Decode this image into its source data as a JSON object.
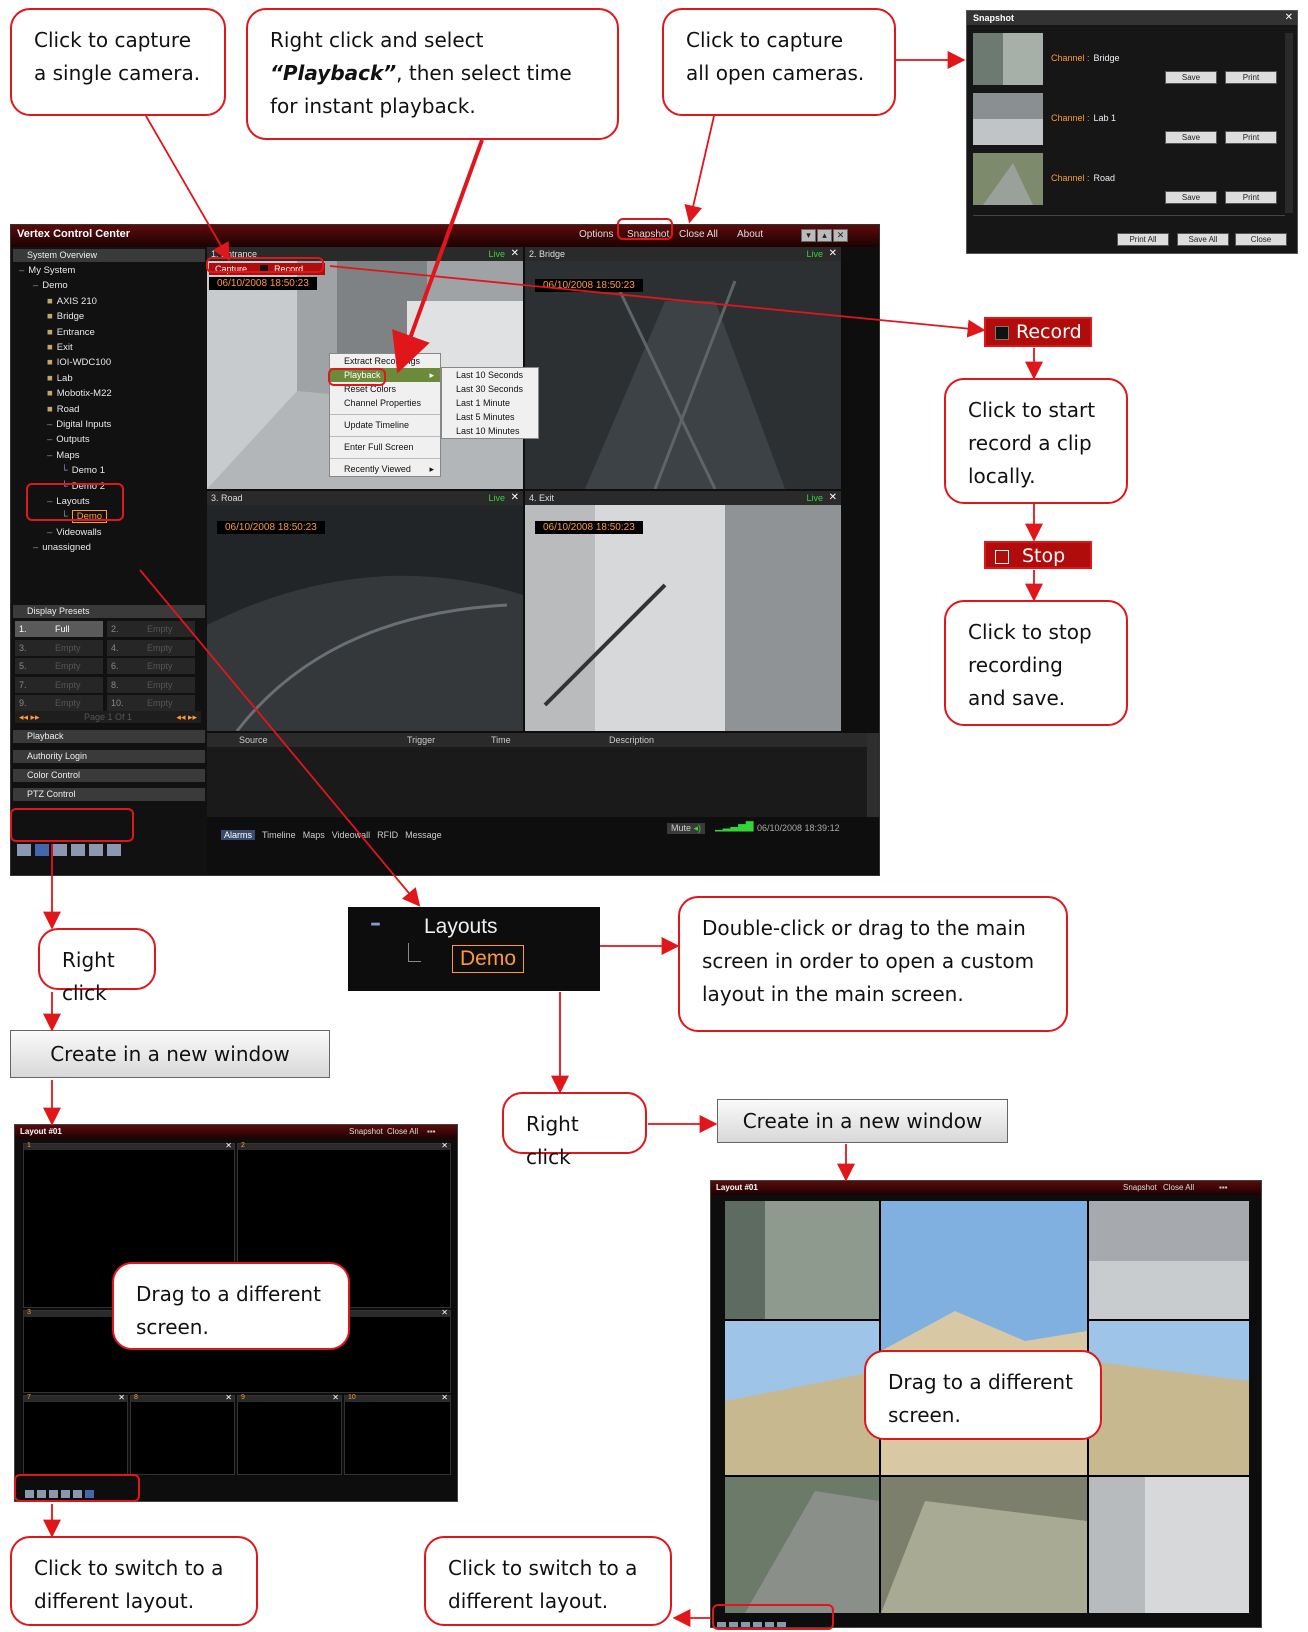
{
  "callouts": {
    "capture_single": "Click to capture a single camera.",
    "playback_pre": "Right click and select ",
    "playback_bold": "“Playback”",
    "playback_post": ", then select time for instant playback.",
    "capture_all": "Click to capture all open cameras.",
    "start_record": "Click to start record a clip locally.",
    "stop_record": "Click to stop recording and save.",
    "right_click_1": "Right click",
    "double_click": "Double-click or drag to the main screen in order to open a custom layout in the main screen.",
    "right_click_2": "Right click",
    "drag_left": "Drag to a different screen.",
    "drag_right": "Drag to a different screen.",
    "switch_left": "Click to switch to a different layout.",
    "switch_right": "Click to switch to a different layout."
  },
  "main_window": {
    "title": "Vertex Control Center",
    "menu": [
      "Options",
      "Snapshot",
      "Close All",
      "About"
    ],
    "window_buttons": [
      "minimize-icon",
      "restore-icon",
      "close-icon"
    ],
    "sidebar": {
      "system_overview": "System Overview",
      "tree": [
        {
          "label": "My System",
          "indent": 0
        },
        {
          "label": "Demo",
          "indent": 1
        },
        {
          "label": "AXIS 210",
          "indent": 2
        },
        {
          "label": "Bridge",
          "indent": 2
        },
        {
          "label": "Entrance",
          "indent": 2
        },
        {
          "label": "Exit",
          "indent": 2
        },
        {
          "label": "IOI-WDC100",
          "indent": 2
        },
        {
          "label": "Lab",
          "indent": 2
        },
        {
          "label": "Mobotix-M22",
          "indent": 2
        },
        {
          "label": "Road",
          "indent": 2
        },
        {
          "label": "Digital Inputs",
          "indent": 2
        },
        {
          "label": "Outputs",
          "indent": 2
        },
        {
          "label": "Maps",
          "indent": 2
        },
        {
          "label": "Demo 1",
          "indent": 3
        },
        {
          "label": "Demo 2",
          "indent": 3
        },
        {
          "label": "Layouts",
          "indent": 2
        },
        {
          "label": "Demo",
          "indent": 3
        },
        {
          "label": "Videowalls",
          "indent": 2
        },
        {
          "label": "unassigned",
          "indent": 1
        }
      ],
      "display_presets": "Display Presets",
      "presets": [
        {
          "num": "1.",
          "label": "Full"
        },
        {
          "num": "2.",
          "label": "Empty"
        },
        {
          "num": "3.",
          "label": "Empty"
        },
        {
          "num": "4.",
          "label": "Empty"
        },
        {
          "num": "5.",
          "label": "Empty"
        },
        {
          "num": "6.",
          "label": "Empty"
        },
        {
          "num": "7.",
          "label": "Empty"
        },
        {
          "num": "8.",
          "label": "Empty"
        },
        {
          "num": "9.",
          "label": "Empty"
        },
        {
          "num": "10.",
          "label": "Empty"
        }
      ],
      "page_label": "Page 1 Of 1",
      "sections": [
        "Playback",
        "Authority Login",
        "Color Control",
        "PTZ Control"
      ]
    },
    "panes": [
      {
        "num": "1.",
        "name": "Entrance",
        "live": "Live",
        "timestamp": "06/10/2008 18:50:23"
      },
      {
        "num": "2.",
        "name": "Bridge",
        "live": "Live",
        "timestamp": "06/10/2008 18:50:23"
      },
      {
        "num": "3.",
        "name": "Road",
        "live": "Live",
        "timestamp": "06/10/2008 18:50:23"
      },
      {
        "num": "4.",
        "name": "Exit",
        "live": "Live",
        "timestamp": "06/10/2008 18:50:23"
      }
    ],
    "capture_label": "Capture",
    "record_label": "Record",
    "context_menu": [
      "Extract Recordings",
      "Playback",
      "Reset Colors",
      "Channel Properties",
      "Update Timeline",
      "Enter Full Screen",
      "Recently Viewed"
    ],
    "playback_submenu": [
      "Last 10 Seconds",
      "Last 30 Seconds",
      "Last 1 Minute",
      "Last 5 Minutes",
      "Last 10 Minutes"
    ],
    "alarm_columns": [
      "Source",
      "Trigger",
      "Time",
      "Description"
    ],
    "bottom_tabs": [
      "Alarms",
      "Timeline",
      "Maps",
      "Videowall",
      "RFID",
      "Message"
    ],
    "mute_label": "Mute",
    "clock": "06/10/2008 18:39:12"
  },
  "snapshot_window": {
    "title": "Snapshot",
    "entries": [
      {
        "channel_label": "Channel :",
        "channel": "Bridge"
      },
      {
        "channel_label": "Channel :",
        "channel": "Lab 1"
      },
      {
        "channel_label": "Channel :",
        "channel": "Road"
      }
    ],
    "save_label": "Save",
    "print_label": "Print",
    "footer": [
      "Print All",
      "Save All",
      "Close"
    ]
  },
  "record_button": "Record",
  "stop_button": "Stop",
  "layouts_zoom": {
    "layouts": "Layouts",
    "demo": "Demo"
  },
  "create_new_window": "Create in a new window",
  "layout_window": {
    "title": "Layout #01",
    "menu": [
      "Snapshot",
      "Close All"
    ],
    "cells_top": [
      "1",
      "2"
    ],
    "cells_mid": [
      "3",
      "",
      "",
      ""
    ],
    "cells_bottom": [
      "7",
      "8",
      "9",
      "10"
    ]
  },
  "colors": {
    "accent_red": "#e0161b",
    "live_green": "#35d435",
    "timestamp_orange": "#ff9a33"
  }
}
